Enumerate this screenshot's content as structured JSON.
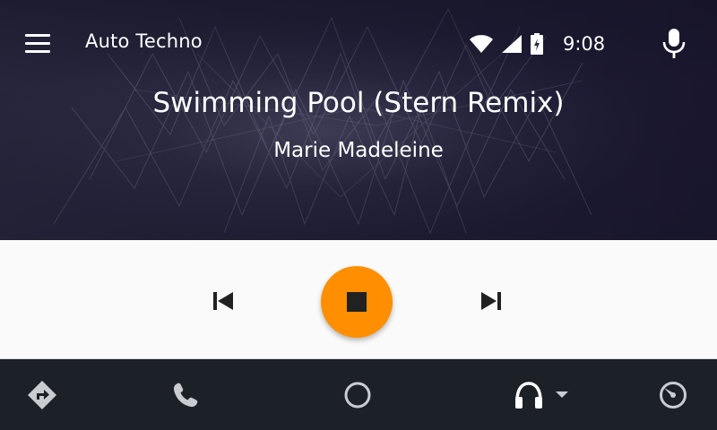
{
  "app": {
    "title": "Auto Techno"
  },
  "status_bar": {
    "time": "9:08",
    "icons": [
      "wifi-icon",
      "cellular-signal-icon",
      "battery-charging-icon"
    ]
  },
  "now_playing": {
    "title": "Swimming Pool (Stern Remix)",
    "artist": "Marie Madeleine"
  },
  "controls": {
    "accent_color": "#ff8f00",
    "buttons": [
      "skip-previous-icon",
      "stop-icon",
      "skip-next-icon"
    ]
  },
  "nav": {
    "items": [
      "navigation-icon",
      "phone-icon",
      "home-icon",
      "headphones-icon",
      "dashboard-gauge-icon"
    ]
  }
}
